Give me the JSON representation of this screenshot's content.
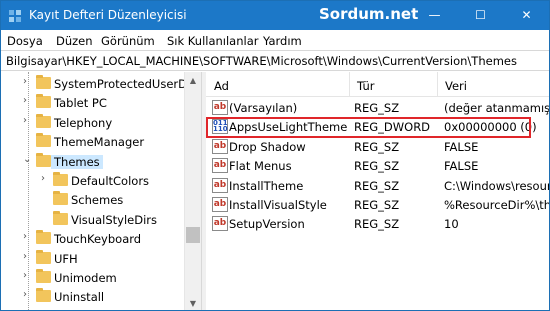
{
  "window": {
    "title": "Kayıt Defteri Düzenleyicisi",
    "watermark": "Sordum.net"
  },
  "controls": {
    "min": "—",
    "max": "☐",
    "close": "✕"
  },
  "menu": [
    "Dosya",
    "Düzen",
    "Görünüm",
    "Sık Kullanılanlar",
    "Yardım"
  ],
  "address": "Bilgisayar\\HKEY_LOCAL_MACHINE\\SOFTWARE\\Microsoft\\Windows\\CurrentVersion\\Themes",
  "tree": [
    {
      "label": "SystemProtectedUserData",
      "expandable": true
    },
    {
      "label": "Tablet PC",
      "expandable": true
    },
    {
      "label": "Telephony",
      "expandable": true
    },
    {
      "label": "ThemeManager",
      "expandable": false
    },
    {
      "label": "Themes",
      "expandable": true,
      "expanded": true,
      "selected": true
    },
    {
      "label": "DefaultColors",
      "expandable": true
    },
    {
      "label": "Schemes",
      "expandable": false
    },
    {
      "label": "VisualStyleDirs",
      "expandable": false
    },
    {
      "label": "TouchKeyboard",
      "expandable": true
    },
    {
      "label": "UFH",
      "expandable": true
    },
    {
      "label": "Unimodem",
      "expandable": true
    },
    {
      "label": "Uninstall",
      "expandable": true
    }
  ],
  "columns": {
    "name": "Ad",
    "type": "Tür",
    "data": "Veri"
  },
  "values": [
    {
      "icon": "ab",
      "name": "(Varsayılan)",
      "type": "REG_SZ",
      "data": "(değer atanmamış)"
    },
    {
      "icon": "dword",
      "name": "AppsUseLightTheme",
      "type": "REG_DWORD",
      "data": "0x00000000 (0)",
      "highlighted": true
    },
    {
      "icon": "ab",
      "name": "Drop Shadow",
      "type": "REG_SZ",
      "data": "FALSE"
    },
    {
      "icon": "ab",
      "name": "Flat Menus",
      "type": "REG_SZ",
      "data": "FALSE"
    },
    {
      "icon": "ab",
      "name": "InstallTheme",
      "type": "REG_SZ",
      "data": "C:\\Windows\\resources\\Themes\\Aero\\Aero.msstyles"
    },
    {
      "icon": "ab",
      "name": "InstallVisualStyle",
      "type": "REG_SZ",
      "data": "%ResourceDir%\\themes\\Aero\\Aero.msstyles"
    },
    {
      "icon": "ab",
      "name": "SetupVersion",
      "type": "REG_SZ",
      "data": "10"
    }
  ],
  "colors": {
    "titlebar": "#1c78c8",
    "highlight_border": "#e0262a",
    "selection": "#cce8ff",
    "folder": "#f2c55c"
  }
}
